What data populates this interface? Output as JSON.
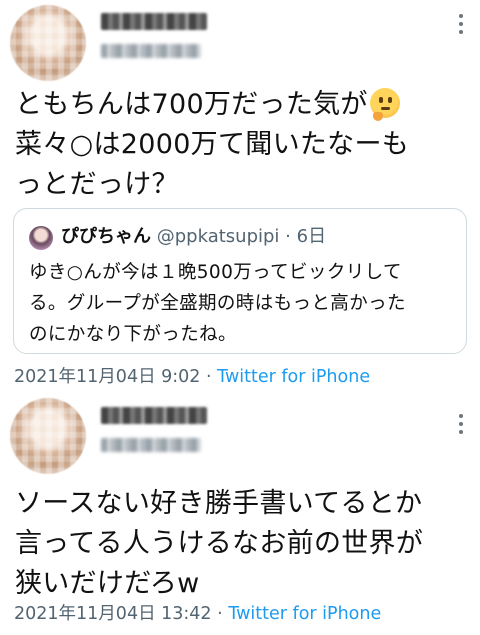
{
  "tweets": [
    {
      "body_lines": [
        "ともちんは700万だった気が",
        "菜々○は2000万て聞いたなーも",
        "っとだっけ？"
      ],
      "emoji": "thinking-face",
      "quote": {
        "name": "ぴぴちゃん",
        "handle": "@ppkatsupipi",
        "separator": "·",
        "date": "6日",
        "text_lines": [
          "ゆき○んが今は１晩500万ってビックリして",
          "る。グループが全盛期の時はもっと高かった",
          "のにかなり下がったね。"
        ]
      },
      "timestamp": "2021年11月04日 9:02",
      "separator": "·",
      "source": "Twitter for iPhone"
    },
    {
      "body_lines": [
        "ソースない好き勝手書いてるとか",
        "言ってる人うけるなお前の世界が",
        "狭いだけだろw"
      ],
      "timestamp": "2021年11月04日 13:42",
      "separator": "·",
      "source": "Twitter for iPhone"
    }
  ],
  "colors": {
    "link": "#1d9bf0",
    "secondary_text": "#536471",
    "border": "#cfd9de"
  }
}
